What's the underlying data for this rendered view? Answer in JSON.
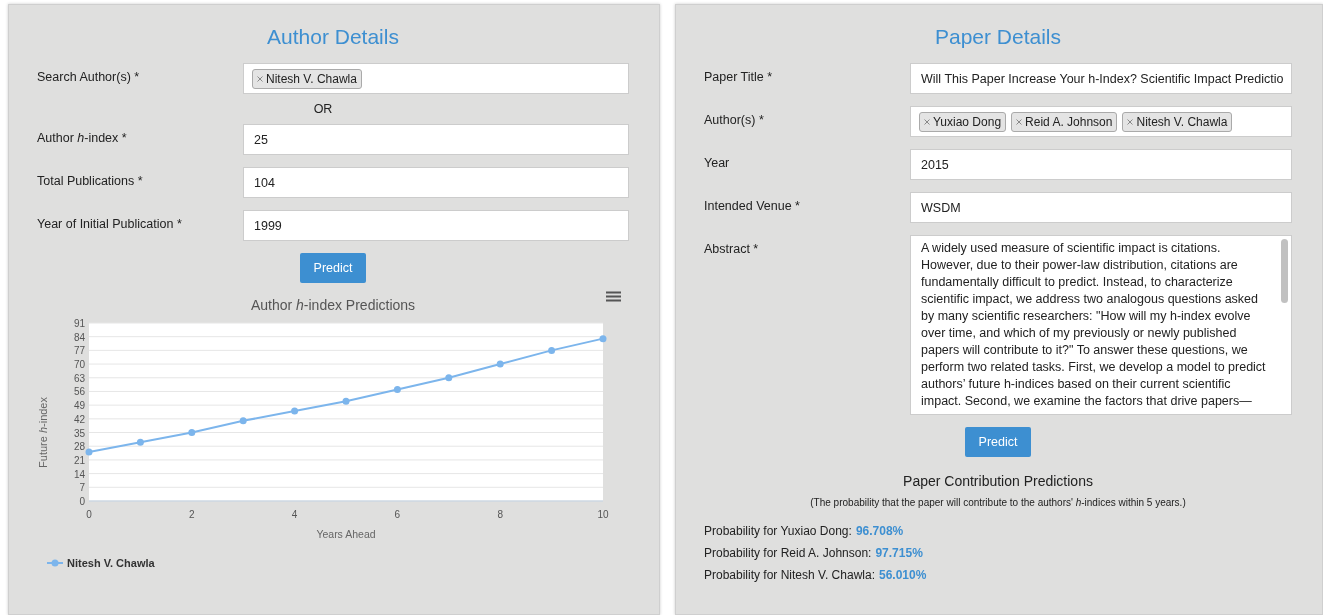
{
  "author": {
    "title": "Author Details",
    "search": {
      "label": "Search Author(s) *",
      "tags": [
        "Nitesh V. Chawla"
      ]
    },
    "separator": "OR",
    "fields": [
      {
        "label": "Author *h*-index *",
        "value": "25"
      },
      {
        "label": "Total Publications *",
        "value": "104"
      },
      {
        "label": "Year of Initial Publication *",
        "value": "1999"
      }
    ],
    "button": "Predict",
    "chart": {
      "chart_data": {
        "type": "line",
        "title": "Author *h*-index Predictions",
        "xlabel": "Years Ahead",
        "ylabel": "Future *h*-index",
        "grid": true,
        "x": [
          0,
          1,
          2,
          3,
          4,
          5,
          6,
          7,
          8,
          9,
          10
        ],
        "series": [
          {
            "name": "Nitesh V. Chawla",
            "color": "#7cb5ec",
            "marker": true,
            "values": [
              25,
              30,
              35,
              41,
              46,
              51,
              57,
              63,
              70,
              77,
              83
            ]
          }
        ],
        "xlim": [
          0,
          10
        ],
        "ylim": [
          0,
          91
        ],
        "xticks": [
          0,
          2,
          4,
          6,
          8,
          10
        ],
        "yticks": [
          0,
          7,
          14,
          21,
          28,
          35,
          42,
          49,
          56,
          63,
          70,
          77,
          84,
          91
        ]
      }
    }
  },
  "paper": {
    "title": "Paper Details",
    "fields": [
      {
        "kind": "text",
        "label": "Paper Title *",
        "value": "Will This Paper Increase Your h-Index? Scientific Impact Predictio"
      },
      {
        "kind": "tags",
        "label": "Author(s) *",
        "tags": [
          "Yuxiao Dong",
          "Reid A. Johnson",
          "Nitesh V. Chawla"
        ]
      },
      {
        "kind": "text",
        "label": "Year",
        "value": "2015"
      },
      {
        "kind": "text",
        "label": "Intended Venue *",
        "value": "WSDM"
      },
      {
        "kind": "textarea",
        "label": "Abstract *",
        "value": "A widely used measure of scientific impact is citations. However, due to their power-law distribution, citations are fundamentally difficult to predict. Instead, to characterize scientific impact, we address two analogous questions asked by many scientific researchers: \"How will my h-index evolve over time, and which of my previously or newly published papers will contribute to it?\" To answer these questions, we perform two related tasks. First, we develop a model to predict authors’ future h-indices based on their current scientific impact. Second, we examine the factors that drive papers—"
      }
    ],
    "button": "Predict",
    "results": {
      "title": "Paper Contribution Predictions",
      "note": "(The probability that the paper will contribute to the authors' *h*-indices within 5 years.)",
      "items": [
        {
          "label": "Probability for Yuxiao Dong:",
          "value": "96.708%"
        },
        {
          "label": "Probability for Reid A. Johnson:",
          "value": "97.715%"
        },
        {
          "label": "Probability for Nitesh V. Chawla:",
          "value": "56.010%"
        }
      ]
    }
  }
}
